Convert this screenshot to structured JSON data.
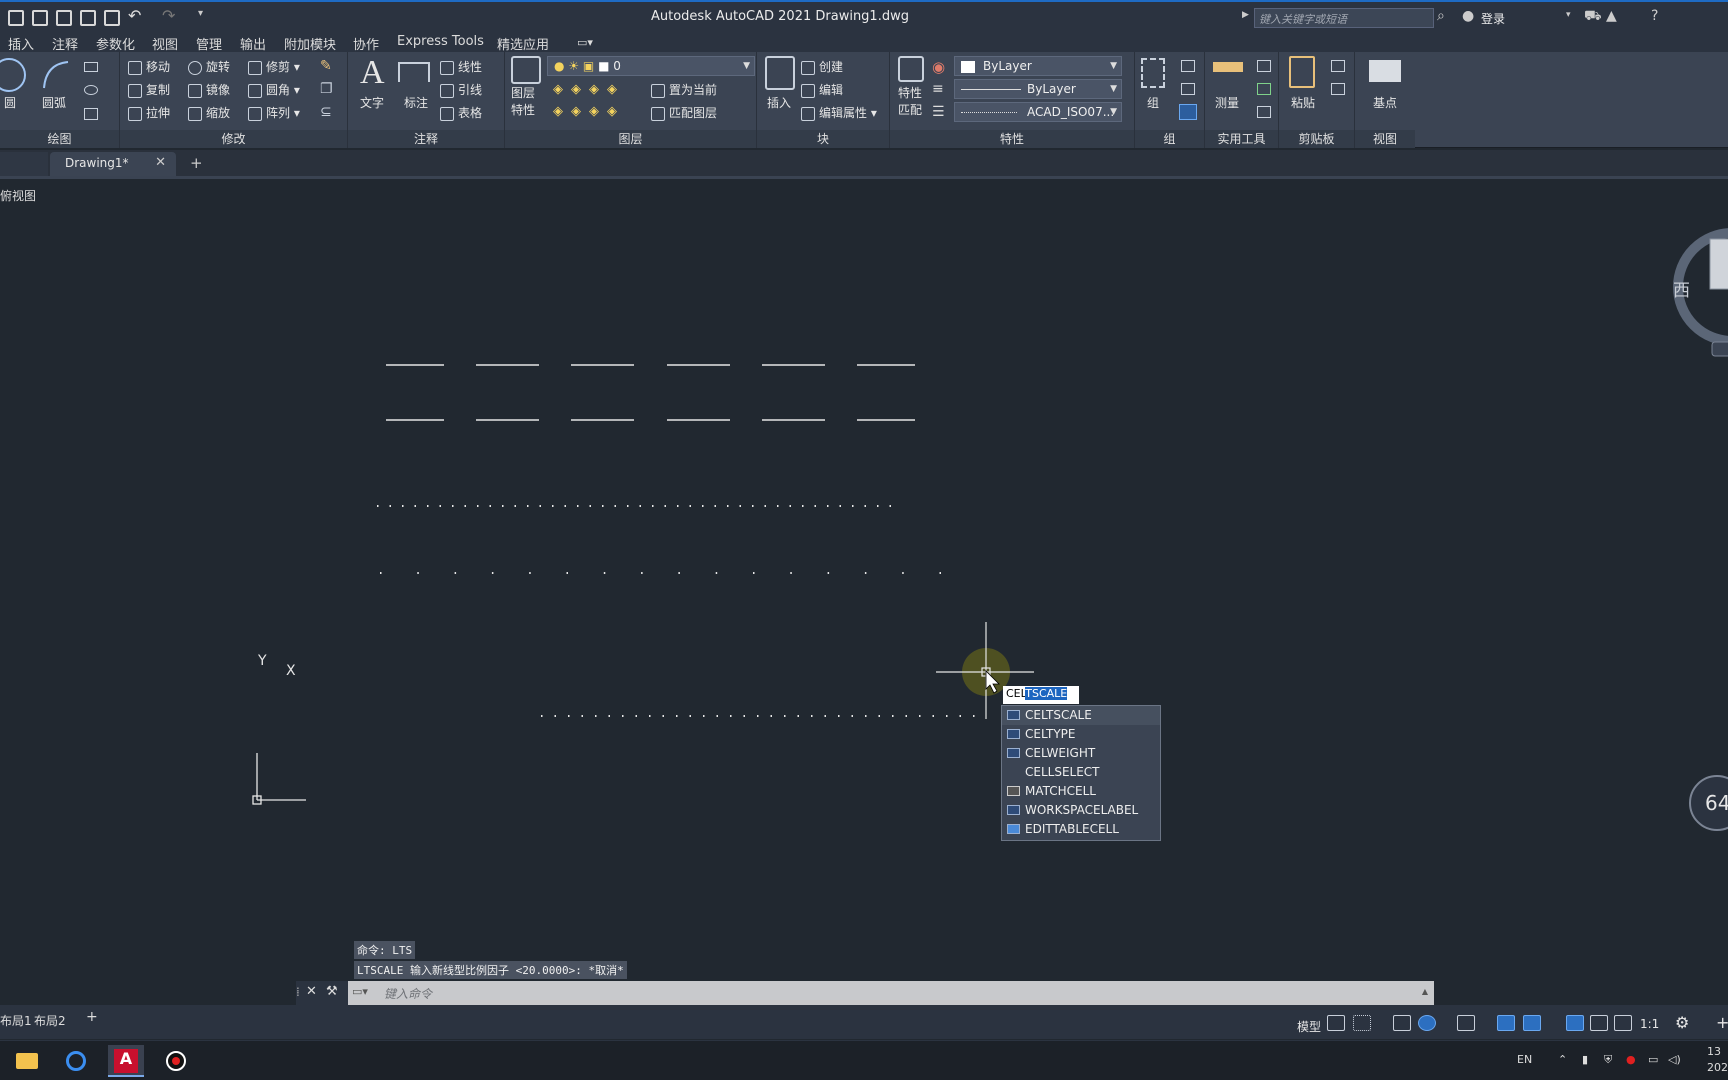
{
  "app": {
    "title": "Autodesk AutoCAD 2021    Drawing1.dwg",
    "search_placeholder": "键入关键字或短语",
    "login_label": "登录"
  },
  "menu_tabs": [
    "插入",
    "注释",
    "参数化",
    "视图",
    "管理",
    "输出",
    "附加模块",
    "协作",
    "Express Tools",
    "精选应用"
  ],
  "ribbon": {
    "draw": {
      "title": "绘图",
      "circle": "圆",
      "arc": "圆弧"
    },
    "modify": {
      "title": "修改",
      "move": "移动",
      "rotate": "旋转",
      "trim": "修剪",
      "copy": "复制",
      "mirror": "镜像",
      "fillet": "圆角",
      "stretch": "拉伸",
      "scale": "缩放",
      "array": "阵列"
    },
    "annotation": {
      "title": "注释",
      "text": "文字",
      "dimension": "标注",
      "linear": "线性",
      "leader": "引线",
      "table": "表格"
    },
    "layers": {
      "title": "图层",
      "layer_props_1": "图层",
      "layer_props_2": "特性",
      "current_layer": "0",
      "set_current": "置为当前",
      "match_layer": "匹配图层"
    },
    "block": {
      "title": "块",
      "insert": "插入",
      "create": "创建",
      "edit": "编辑",
      "edit_attr": "编辑属性"
    },
    "properties": {
      "title": "特性",
      "match_1": "特性",
      "match_2": "匹配",
      "color": "ByLayer",
      "lineweight": "ByLayer",
      "linetype": "ACAD_ISO07..."
    },
    "groups": {
      "title": "组",
      "group": "组"
    },
    "utilities": {
      "title": "实用工具",
      "measure": "测量"
    },
    "clipboard": {
      "title": "剪贴板",
      "paste": "粘贴"
    },
    "view": {
      "title": "视图",
      "base": "基点"
    }
  },
  "file_tab": {
    "label": "Drawing1*"
  },
  "viewport": {
    "label": "俯视图",
    "viewcube_west": "西",
    "ucs_x": "X",
    "ucs_y": "Y",
    "nav_value": "64"
  },
  "autocomplete": {
    "typed": "CEL",
    "completion": "TSCALE",
    "items": [
      "CELTSCALE",
      "CELTYPE",
      "CELWEIGHT",
      "CELLSELECT",
      "MATCHCELL",
      "WORKSPACELABEL",
      "EDITTABLECELL"
    ]
  },
  "command": {
    "history_1": "命令: LTS",
    "history_2": "LTSCALE 输入新线型比例因子 <20.0000>: *取消*",
    "placeholder": "键入命令"
  },
  "layout_tabs": [
    "布局1",
    "布局2"
  ],
  "status": {
    "model": "模型",
    "scale": "1:1"
  },
  "taskbar": {
    "lang": "EN",
    "time": "13",
    "date": "202"
  }
}
